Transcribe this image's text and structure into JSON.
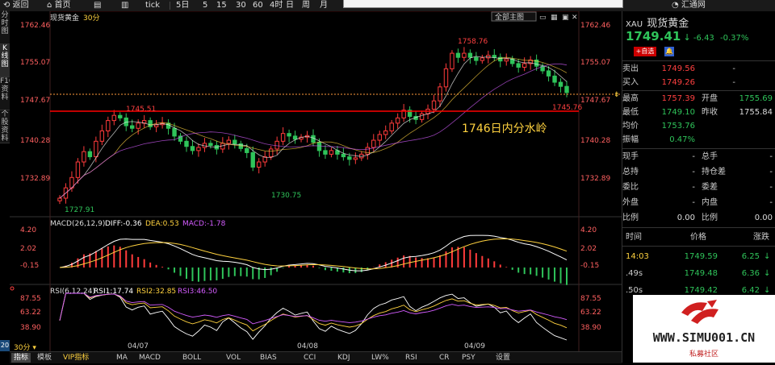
{
  "toolbar": {
    "back": "返回",
    "home": "首页",
    "tick": "tick",
    "day5": "5日",
    "m5": "5",
    "m15": "15",
    "m30": "30",
    "m60": "60",
    "h4": "4时",
    "day": "日",
    "week": "周",
    "month": "月",
    "brand": "汇通网"
  },
  "side_tabs": [
    "分时图",
    "K线图",
    "F10资料",
    "个股资料"
  ],
  "chart": {
    "symbol": "现货黄金",
    "period": "30分",
    "overlay_btn": "全部主图",
    "y_ticks": [
      "1762.46",
      "1755.07",
      "1747.67",
      "1740.28",
      "1732.89"
    ],
    "high_label": "1758.76",
    "low_label": "1727.91",
    "low2_label": "1730.75",
    "peak1_label": "1745.51",
    "support_label": "1745.76",
    "annotation": "1746日内分水岭",
    "dates": [
      "04/07",
      "04/08",
      "04/09"
    ]
  },
  "macd": {
    "title": "MACD(26,12,9)",
    "diff": "DIFF:-0.36",
    "dea": "DEA:0.53",
    "macd": "MACD:-1.78",
    "ticks": [
      "4.20",
      "2.02",
      "-0.15"
    ]
  },
  "rsi": {
    "title": "RSI(6,12,24)",
    "rsi1": "RSI1:17.74",
    "rsi2": "RSI2:32.85",
    "rsi3": "RSI3:46.50",
    "ticks": [
      "87.55",
      "63.22",
      "38.90"
    ]
  },
  "bottom_tabs": [
    "指标",
    "模板",
    "VIP指标",
    "MA",
    "MACD",
    "BOLL",
    "VOL",
    "BIAS",
    "CCI",
    "KDJ",
    "LW%",
    "RSI",
    "CR",
    "PSY",
    "设置"
  ],
  "bottom_left": "30分",
  "bottom_left_num": "20",
  "quote": {
    "code": "XAU",
    "name": "现货黄金",
    "price": "1749.41",
    "arrow": "↓",
    "change": "-6.43",
    "pct": "-0.37%",
    "alert": "自选",
    "sell_label": "卖出",
    "sell": "1749.56",
    "sell_dash": "-",
    "buy_label": "买入",
    "buy": "1749.26",
    "buy_dash": "-",
    "high_label": "最高",
    "high": "1757.39",
    "open_label": "开盘",
    "open": "1755.69",
    "low_label": "最低",
    "low": "1749.10",
    "prev_label": "昨收",
    "prev": "1755.84",
    "avg_label": "均价",
    "avg": "1753.76",
    "amp_label": "振幅",
    "amp": "0.47%",
    "rows": [
      {
        "l1": "现手",
        "v1": "-",
        "l2": "总手",
        "v2": "-"
      },
      {
        "l1": "总持",
        "v1": "-",
        "l2": "持仓差",
        "v2": "-"
      },
      {
        "l1": "委比",
        "v1": "-",
        "l2": "委差",
        "v2": "-"
      },
      {
        "l1": "外盘",
        "v1": "-",
        "l2": "内盘",
        "v2": "-"
      },
      {
        "l1": "比例",
        "v1": "0.00",
        "l2": "比例",
        "v2": "0.00"
      }
    ],
    "ticks_header": {
      "time": "时间",
      "price": "价格",
      "chg": "涨跌"
    },
    "ticks": [
      {
        "time": "14:03",
        "price": "1749.59",
        "chg": "6.25"
      },
      {
        "time": ".49s",
        "price": "1749.48",
        "chg": "6.36"
      },
      {
        "time": ".50s",
        "price": "1749.42",
        "chg": "6.42"
      }
    ]
  },
  "watermark": {
    "site": "WWW.SIMU001.CN",
    "sub": "私募社区"
  },
  "colors": {
    "up": "#ff3b3b",
    "down": "#2fc45a",
    "accent_red": "#ff0000",
    "yellow": "#ffd23f",
    "magenta": "#d45cff"
  }
}
